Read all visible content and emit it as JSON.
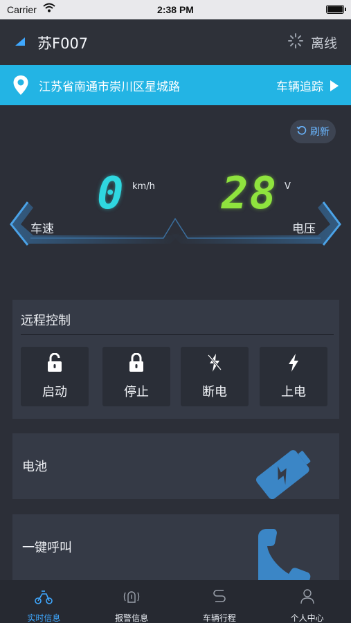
{
  "status_bar": {
    "carrier": "Carrier",
    "time": "2:38 PM"
  },
  "header": {
    "plate": "苏F007",
    "connection_status": "离线"
  },
  "location": {
    "address": "江苏省南通市崇川区星城路",
    "track_label": "车辆追踪"
  },
  "refresh_label": "刷新",
  "dashboard": {
    "speed_value": "0",
    "speed_unit": "km/h",
    "speed_label": "车速",
    "voltage_value": "28",
    "voltage_unit": "V",
    "voltage_label": "电压"
  },
  "remote_control": {
    "title": "远程控制",
    "buttons": [
      {
        "label": "启动",
        "icon": "unlock-icon"
      },
      {
        "label": "停止",
        "icon": "lock-icon"
      },
      {
        "label": "断电",
        "icon": "power-off-icon"
      },
      {
        "label": "上电",
        "icon": "power-on-icon"
      }
    ]
  },
  "cards": [
    {
      "label": "电池",
      "icon": "battery-icon"
    },
    {
      "label": "一键呼叫",
      "icon": "phone-icon"
    }
  ],
  "tabs": [
    {
      "label": "实时信息",
      "icon": "scooter-icon",
      "active": true
    },
    {
      "label": "报警信息",
      "icon": "alarm-icon",
      "active": false
    },
    {
      "label": "车辆行程",
      "icon": "route-icon",
      "active": false
    },
    {
      "label": "个人中心",
      "icon": "user-icon",
      "active": false
    }
  ],
  "colors": {
    "accent": "#23b4e4",
    "speed_digits": "#2fd7e0",
    "voltage_digits": "#8fe33e",
    "tab_active": "#3fa8ff",
    "background": "#2c2f38"
  }
}
